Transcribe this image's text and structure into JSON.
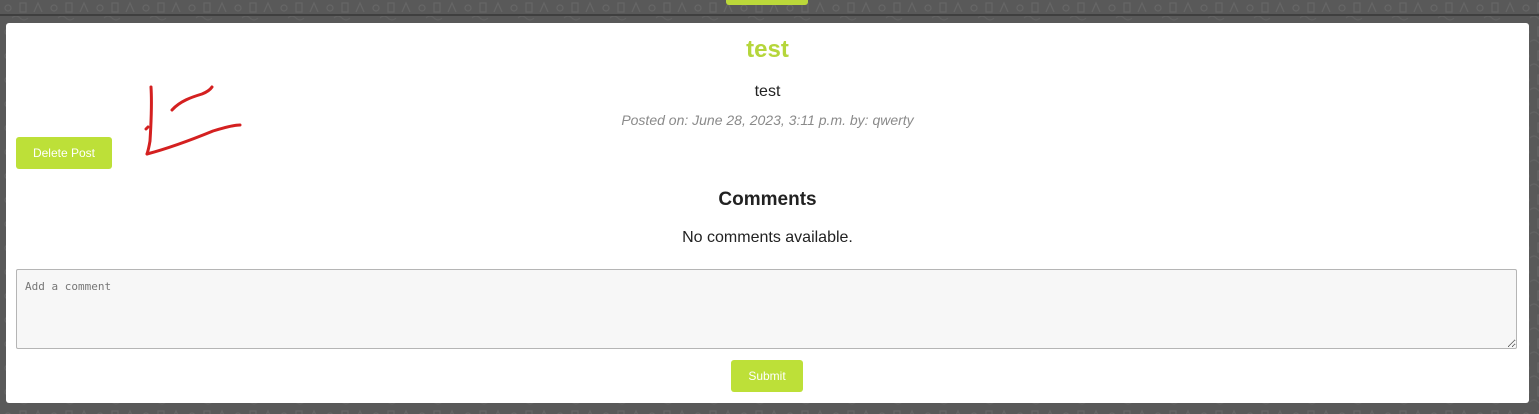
{
  "post": {
    "title": "test",
    "body": "test",
    "meta": "Posted on: June 28, 2023, 3:11 p.m. by: qwerty",
    "delete_label": "Delete Post"
  },
  "comments": {
    "heading": "Comments",
    "empty_text": "No comments available.",
    "input_placeholder": "Add a comment",
    "input_value": "",
    "submit_label": "Submit"
  },
  "colors": {
    "accent": "#bde038",
    "title": "#b5d63b",
    "page_background": "#595959",
    "annotation": "#d42020"
  },
  "annotation": {
    "icon": "red-hand-drawn-arrow-icon"
  }
}
